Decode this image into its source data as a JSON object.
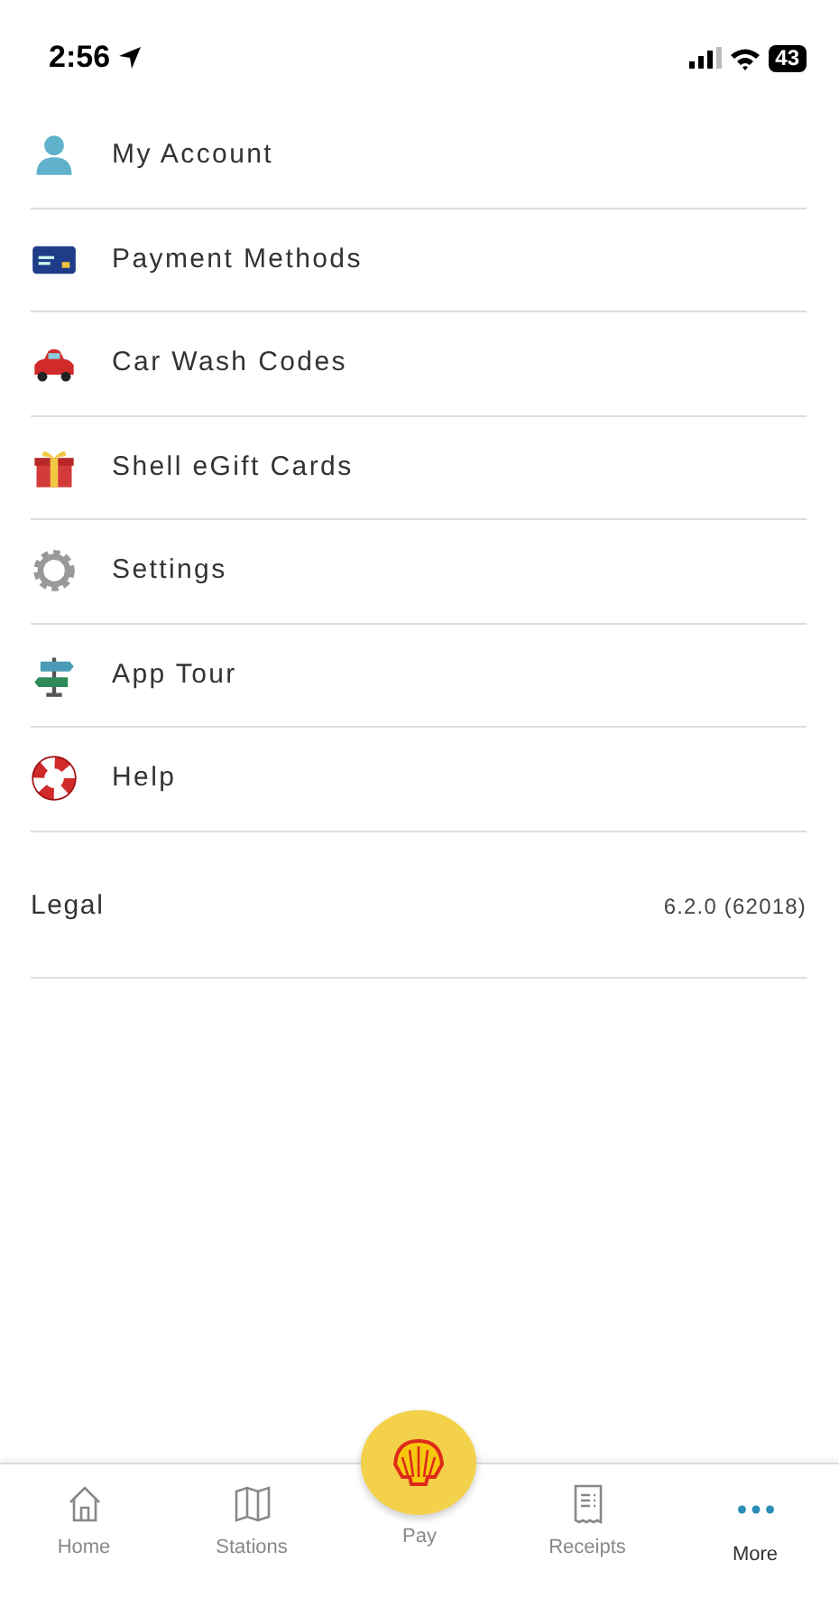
{
  "status_bar": {
    "time": "2:56",
    "battery": "43"
  },
  "menu": [
    {
      "kind": "account",
      "label": "My Account"
    },
    {
      "kind": "payment",
      "label": "Payment Methods"
    },
    {
      "kind": "car",
      "label": "Car Wash Codes"
    },
    {
      "kind": "gift",
      "label": "Shell eGift Cards"
    },
    {
      "kind": "settings",
      "label": "Settings"
    },
    {
      "kind": "tour",
      "label": "App Tour"
    },
    {
      "kind": "help",
      "label": "Help"
    }
  ],
  "legal": {
    "label": "Legal",
    "version": "6.2.0 (62018)"
  },
  "tab_bar": [
    {
      "kind": "home",
      "label": "Home",
      "selected": false
    },
    {
      "kind": "stations",
      "label": "Stations",
      "selected": false
    },
    {
      "kind": "pay",
      "label": "Pay",
      "selected": false
    },
    {
      "kind": "receipts",
      "label": "Receipts",
      "selected": false
    },
    {
      "kind": "more",
      "label": "More",
      "selected": true
    }
  ]
}
